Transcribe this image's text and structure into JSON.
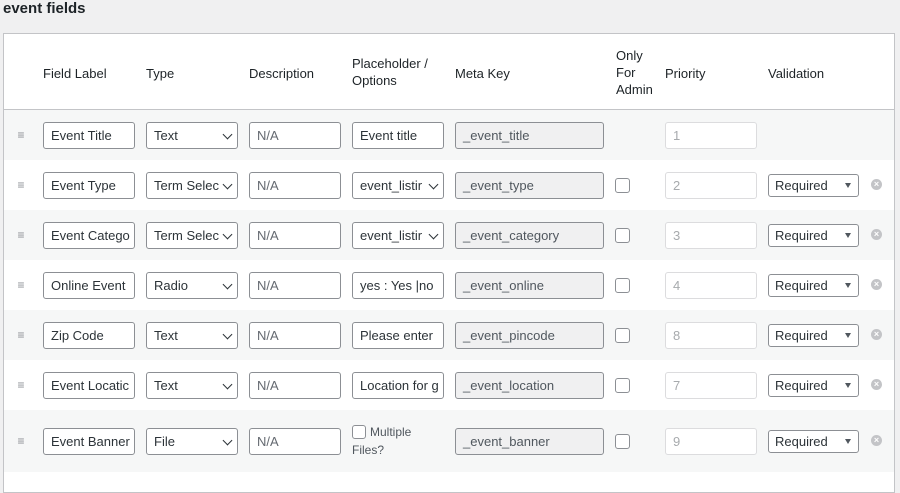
{
  "section_title": "event fields",
  "columns": {
    "field_label": "Field Label",
    "type": "Type",
    "description": "Description",
    "placeholder_line1": "Placeholder /",
    "placeholder_line2": "Options",
    "meta_key": "Meta Key",
    "only_line1": "Only",
    "only_line2": "For",
    "only_line3": "Admin",
    "priority": "Priority",
    "validation": "Validation"
  },
  "rows": [
    {
      "label": "Event Title",
      "type": "Text",
      "description": "N/A",
      "placeholder": "Event title",
      "meta_key": "_event_title",
      "priority": "1"
    },
    {
      "label": "Event Type",
      "type": "Term Selec",
      "description": "N/A",
      "placeholder": "event_listir",
      "meta_key": "_event_type",
      "priority": "2",
      "validation": "Required"
    },
    {
      "label": "Event Catego",
      "type": "Term Selec",
      "description": "N/A",
      "placeholder": "event_listir",
      "meta_key": "_event_category",
      "priority": "3",
      "validation": "Required"
    },
    {
      "label": "Online Event",
      "type": "Radio",
      "description": "N/A",
      "placeholder": "yes : Yes |no",
      "meta_key": "_event_online",
      "priority": "4",
      "validation": "Required"
    },
    {
      "label": "Zip Code",
      "type": "Text",
      "description": "N/A",
      "placeholder": "Please enter",
      "meta_key": "_event_pincode",
      "priority": "8",
      "validation": "Required"
    },
    {
      "label": "Event Locatic",
      "type": "Text",
      "description": "N/A",
      "placeholder": "Location for g",
      "meta_key": "_event_location",
      "priority": "7",
      "validation": "Required"
    },
    {
      "label": "Event Banner",
      "type": "File",
      "description": "N/A",
      "multiple_line1": "Multiple",
      "multiple_line2": "Files?",
      "meta_key": "_event_banner",
      "priority": "9",
      "validation": "Required"
    }
  ]
}
